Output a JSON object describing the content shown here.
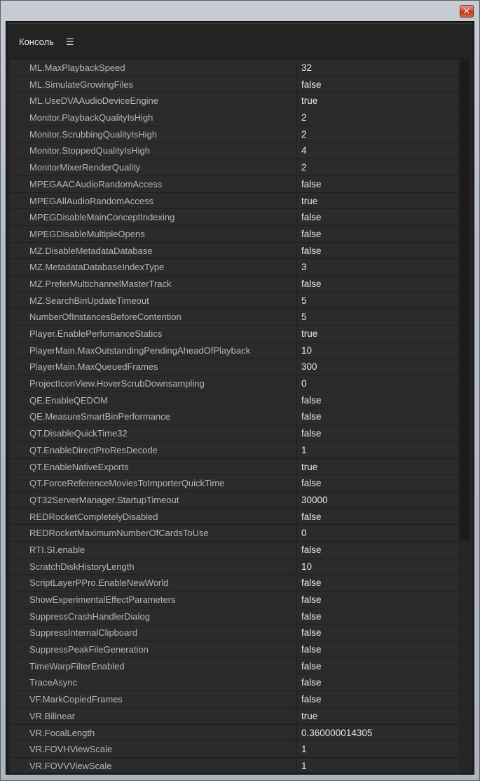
{
  "window": {
    "close_glyph": "✕"
  },
  "panel": {
    "title": "Консоль",
    "menu_glyph": "☰"
  },
  "rows": [
    {
      "key": "ML.MaxPlaybackSpeed",
      "value": "32"
    },
    {
      "key": "ML.SimulateGrowingFiles",
      "value": "false"
    },
    {
      "key": "ML.UseDVAAudioDeviceEngine",
      "value": "true"
    },
    {
      "key": "Monitor.PlaybackQualityIsHigh",
      "value": "2"
    },
    {
      "key": "Monitor.ScrubbingQualityIsHigh",
      "value": "2"
    },
    {
      "key": "Monitor.StoppedQualityIsHigh",
      "value": "4"
    },
    {
      "key": "MonitorMixerRenderQuality",
      "value": "2"
    },
    {
      "key": "MPEGAACAudioRandomAccess",
      "value": "false"
    },
    {
      "key": "MPEGAllAudioRandomAccess",
      "value": "true"
    },
    {
      "key": "MPEGDisableMainConceptIndexing",
      "value": "false"
    },
    {
      "key": "MPEGDisableMultipleOpens",
      "value": "false"
    },
    {
      "key": "MZ.DisableMetadataDatabase",
      "value": "false"
    },
    {
      "key": "MZ.MetadataDatabaseIndexType",
      "value": "3"
    },
    {
      "key": "MZ.PreferMultichannelMasterTrack",
      "value": "false"
    },
    {
      "key": "MZ.SearchBinUpdateTimeout",
      "value": "5"
    },
    {
      "key": "NumberOfInstancesBeforeContention",
      "value": "5"
    },
    {
      "key": "Player.EnablePerfomanceStatics",
      "value": "true"
    },
    {
      "key": "PlayerMain.MaxOutstandingPendingAheadOfPlayback",
      "value": "10"
    },
    {
      "key": "PlayerMain.MaxQueuedFrames",
      "value": "300"
    },
    {
      "key": "ProjectIconView.HoverScrubDownsampling",
      "value": "0"
    },
    {
      "key": "QE.EnableQEDOM",
      "value": "false"
    },
    {
      "key": "QE.MeasureSmartBinPerformance",
      "value": "false"
    },
    {
      "key": "QT.DisableQuickTime32",
      "value": "false"
    },
    {
      "key": "QT.EnableDirectProResDecode",
      "value": "1"
    },
    {
      "key": "QT.EnableNativeExports",
      "value": "true"
    },
    {
      "key": "QT.ForceReferenceMoviesToImporterQuickTime",
      "value": "false"
    },
    {
      "key": "QT32ServerManager.StartupTimeout",
      "value": "30000"
    },
    {
      "key": "REDRocketCompletelyDisabled",
      "value": "false"
    },
    {
      "key": "REDRocketMaximumNumberOfCardsToUse",
      "value": "0"
    },
    {
      "key": "RTI.SI.enable",
      "value": "false"
    },
    {
      "key": "ScratchDiskHistoryLength",
      "value": "10"
    },
    {
      "key": "ScriptLayerPPro.EnableNewWorld",
      "value": "false"
    },
    {
      "key": "ShowExperimentalEffectParameters",
      "value": "false"
    },
    {
      "key": "SuppressCrashHandlerDialog",
      "value": "false"
    },
    {
      "key": "SuppressInternalClipboard",
      "value": "false"
    },
    {
      "key": "SuppressPeakFileGeneration",
      "value": "false"
    },
    {
      "key": "TimeWarpFilterEnabled",
      "value": "false"
    },
    {
      "key": "TraceAsync",
      "value": "false"
    },
    {
      "key": "VF.MarkCopiedFrames",
      "value": "false"
    },
    {
      "key": "VR.Bilinear",
      "value": "true"
    },
    {
      "key": "VR.FocalLength",
      "value": "0.360000014305"
    },
    {
      "key": "VR.FOVHViewScale",
      "value": "1"
    },
    {
      "key": "VR.FOVVViewScale",
      "value": "1"
    }
  ],
  "colors": {
    "panel_bg": "#232323",
    "row_bg": "#2b2b2b",
    "key_text": "#b7b7b7",
    "value_text": "#e8e8e8"
  }
}
